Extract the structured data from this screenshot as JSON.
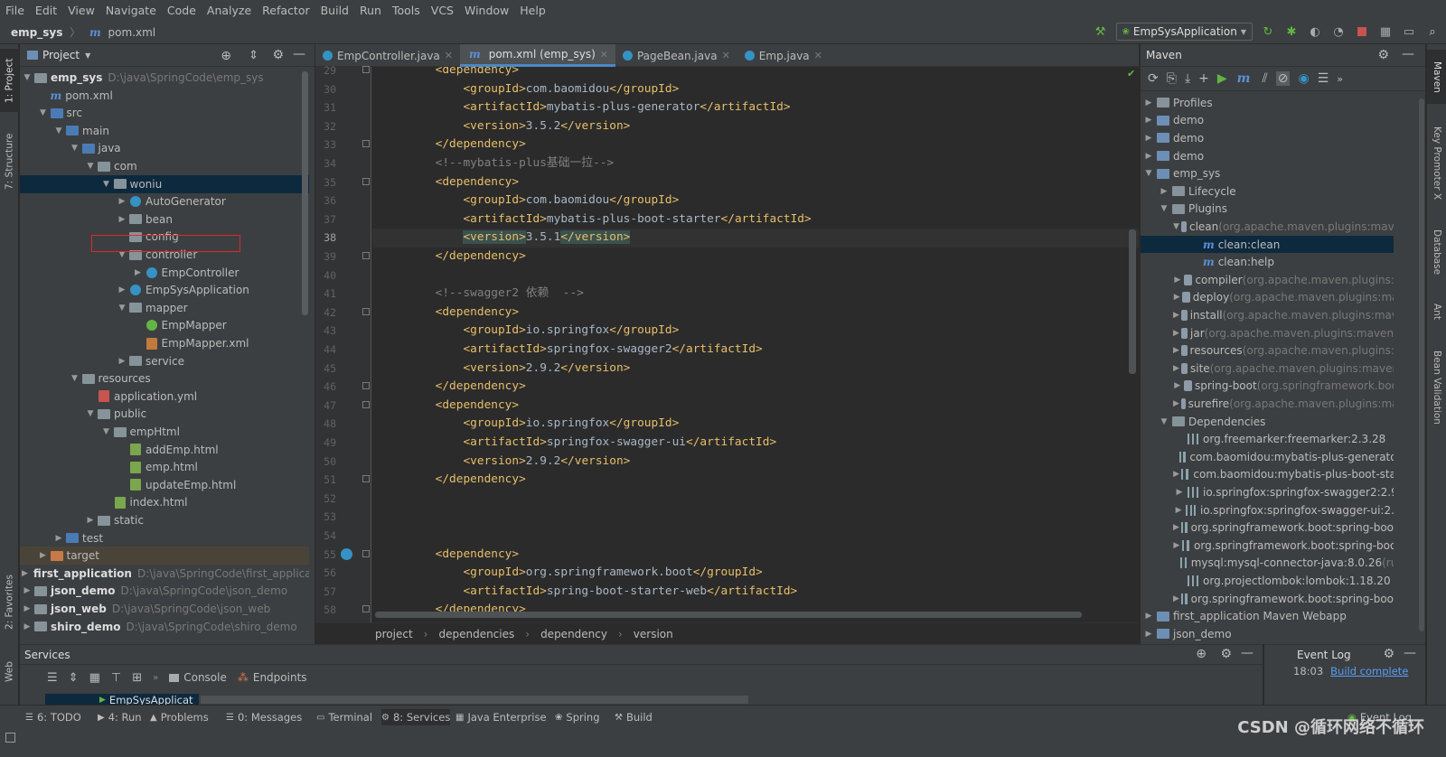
{
  "menu": [
    "File",
    "Edit",
    "View",
    "Navigate",
    "Code",
    "Analyze",
    "Refactor",
    "Build",
    "Run",
    "Tools",
    "VCS",
    "Window",
    "Help"
  ],
  "nav": {
    "project": "emp_sys",
    "file": "pom.xml",
    "run_config": "EmpSysApplication"
  },
  "left_tabs": {
    "project": "1: Project",
    "structure": "7: Structure",
    "favorites": "2: Favorites",
    "web": "Web"
  },
  "right_tabs": {
    "maven": "Maven",
    "key_promoter": "Key Promoter X",
    "database": "Database",
    "ant": "Ant",
    "bean_validation": "Bean Validation"
  },
  "project_panel": {
    "title": "Project",
    "rows": [
      {
        "label": "emp_sys",
        "path": "D:\\java\\SpringCode\\emp_sys",
        "type": "folder",
        "depth": 0,
        "arrow": "▼",
        "bold": true
      },
      {
        "label": "pom.xml",
        "type": "maven",
        "depth": 1,
        "arrow": ""
      },
      {
        "label": "src",
        "type": "folder",
        "depth": 1,
        "arrow": "▼"
      },
      {
        "label": "main",
        "type": "folder",
        "depth": 2,
        "arrow": "▼"
      },
      {
        "label": "java",
        "type": "folder",
        "depth": 3,
        "arrow": "▼"
      },
      {
        "label": "com",
        "type": "pkg",
        "depth": 4,
        "arrow": "▼"
      },
      {
        "label": "woniu",
        "type": "pkg",
        "depth": 5,
        "arrow": "▼",
        "selected": true
      },
      {
        "label": "AutoGenerator",
        "type": "java",
        "depth": 6,
        "arrow": "▶"
      },
      {
        "label": "bean",
        "type": "pkg",
        "depth": 6,
        "arrow": "▶"
      },
      {
        "label": "config",
        "type": "pkg",
        "depth": 6,
        "arrow": "",
        "boxed": true
      },
      {
        "label": "controller",
        "type": "pkg",
        "depth": 6,
        "arrow": "▼"
      },
      {
        "label": "EmpController",
        "type": "java",
        "depth": 7,
        "arrow": "▶"
      },
      {
        "label": "EmpSysApplication",
        "type": "java",
        "depth": 6,
        "arrow": "▶"
      },
      {
        "label": "mapper",
        "type": "pkg",
        "depth": 6,
        "arrow": "▼"
      },
      {
        "label": "EmpMapper",
        "type": "iface",
        "depth": 7,
        "arrow": ""
      },
      {
        "label": "EmpMapper.xml",
        "type": "xml",
        "depth": 7,
        "arrow": ""
      },
      {
        "label": "service",
        "type": "pkg",
        "depth": 6,
        "arrow": "▶"
      },
      {
        "label": "resources",
        "type": "folder",
        "depth": 3,
        "arrow": "▼"
      },
      {
        "label": "application.yml",
        "type": "yml",
        "depth": 4,
        "arrow": ""
      },
      {
        "label": "public",
        "type": "folder",
        "depth": 4,
        "arrow": "▼"
      },
      {
        "label": "empHtml",
        "type": "folder",
        "depth": 5,
        "arrow": "▼"
      },
      {
        "label": "addEmp.html",
        "type": "html",
        "depth": 6,
        "arrow": ""
      },
      {
        "label": "emp.html",
        "type": "html",
        "depth": 6,
        "arrow": ""
      },
      {
        "label": "updateEmp.html",
        "type": "html",
        "depth": 6,
        "arrow": ""
      },
      {
        "label": "index.html",
        "type": "html",
        "depth": 5,
        "arrow": ""
      },
      {
        "label": "static",
        "type": "folder",
        "depth": 4,
        "arrow": "▶"
      },
      {
        "label": "test",
        "type": "folder",
        "depth": 2,
        "arrow": "▶"
      },
      {
        "label": "target",
        "type": "folder",
        "depth": 1,
        "arrow": "▶",
        "target": true
      },
      {
        "label": "first_application",
        "path": "D:\\java\\SpringCode\\first_application",
        "type": "folder",
        "depth": 0,
        "arrow": "▶",
        "bold": true
      },
      {
        "label": "json_demo",
        "path": "D:\\java\\SpringCode\\json_demo",
        "type": "folder",
        "depth": 0,
        "arrow": "▶",
        "bold": true
      },
      {
        "label": "json_web",
        "path": "D:\\java\\SpringCode\\json_web",
        "type": "folder",
        "depth": 0,
        "arrow": "▶",
        "bold": true
      },
      {
        "label": "shiro_demo",
        "path": "D:\\java\\SpringCode\\shiro_demo",
        "type": "folder",
        "depth": 0,
        "arrow": "▶",
        "bold": true
      }
    ]
  },
  "editor": {
    "tabs": [
      {
        "label": "EmpController.java",
        "active": false
      },
      {
        "label": "pom.xml (emp_sys)",
        "active": true
      },
      {
        "label": "PageBean.java",
        "active": false
      },
      {
        "label": "Emp.java",
        "active": false
      }
    ],
    "lines": [
      {
        "n": "29",
        "indent": 2,
        "parts": [
          [
            "tg",
            "<dependency>"
          ]
        ]
      },
      {
        "n": "30",
        "indent": 3,
        "parts": [
          [
            "tg",
            "<groupId>"
          ],
          [
            "tx",
            "com.baomidou"
          ],
          [
            "tg",
            "</groupId>"
          ]
        ]
      },
      {
        "n": "31",
        "indent": 3,
        "parts": [
          [
            "tg",
            "<artifactId>"
          ],
          [
            "tx",
            "mybatis-plus-generator"
          ],
          [
            "tg",
            "</artifactId>"
          ]
        ]
      },
      {
        "n": "32",
        "indent": 3,
        "parts": [
          [
            "tg",
            "<version>"
          ],
          [
            "tx",
            "3.5.2"
          ],
          [
            "tg",
            "</version>"
          ]
        ]
      },
      {
        "n": "33",
        "indent": 2,
        "parts": [
          [
            "tg",
            "</dependency>"
          ]
        ]
      },
      {
        "n": "34",
        "indent": 2,
        "parts": [
          [
            "cm",
            "<!--mybatis-plus基础一拉-->"
          ]
        ]
      },
      {
        "n": "35",
        "indent": 2,
        "parts": [
          [
            "tg",
            "<dependency>"
          ]
        ]
      },
      {
        "n": "36",
        "indent": 3,
        "parts": [
          [
            "tg",
            "<groupId>"
          ],
          [
            "tx",
            "com.baomidou"
          ],
          [
            "tg",
            "</groupId>"
          ]
        ]
      },
      {
        "n": "37",
        "indent": 3,
        "parts": [
          [
            "tg",
            "<artifactId>"
          ],
          [
            "tx",
            "mybatis-plus-boot-starter"
          ],
          [
            "tg",
            "</artifactId>"
          ]
        ]
      },
      {
        "n": "38",
        "indent": 3,
        "parts": [
          [
            "tg",
            "<version>"
          ],
          [
            "tx",
            "3.5.1"
          ],
          [
            "tg",
            "</version>"
          ]
        ],
        "current": true
      },
      {
        "n": "39",
        "indent": 2,
        "parts": [
          [
            "tg",
            "</dependency>"
          ]
        ]
      },
      {
        "n": "40",
        "indent": 0,
        "parts": []
      },
      {
        "n": "41",
        "indent": 2,
        "parts": [
          [
            "cm",
            "<!--swagger2 依赖  -->"
          ]
        ]
      },
      {
        "n": "42",
        "indent": 2,
        "parts": [
          [
            "tg",
            "<dependency>"
          ]
        ]
      },
      {
        "n": "43",
        "indent": 3,
        "parts": [
          [
            "tg",
            "<groupId>"
          ],
          [
            "tx",
            "io.springfox"
          ],
          [
            "tg",
            "</groupId>"
          ]
        ]
      },
      {
        "n": "44",
        "indent": 3,
        "parts": [
          [
            "tg",
            "<artifactId>"
          ],
          [
            "tx",
            "springfox-swagger2"
          ],
          [
            "tg",
            "</artifactId>"
          ]
        ]
      },
      {
        "n": "45",
        "indent": 3,
        "parts": [
          [
            "tg",
            "<version>"
          ],
          [
            "tx",
            "2.9.2"
          ],
          [
            "tg",
            "</version>"
          ]
        ]
      },
      {
        "n": "46",
        "indent": 2,
        "parts": [
          [
            "tg",
            "</dependency>"
          ]
        ]
      },
      {
        "n": "47",
        "indent": 2,
        "parts": [
          [
            "tg",
            "<dependency>"
          ]
        ]
      },
      {
        "n": "48",
        "indent": 3,
        "parts": [
          [
            "tg",
            "<groupId>"
          ],
          [
            "tx",
            "io.springfox"
          ],
          [
            "tg",
            "</groupId>"
          ]
        ]
      },
      {
        "n": "49",
        "indent": 3,
        "parts": [
          [
            "tg",
            "<artifactId>"
          ],
          [
            "tx",
            "springfox-swagger-ui"
          ],
          [
            "tg",
            "</artifactId>"
          ]
        ]
      },
      {
        "n": "50",
        "indent": 3,
        "parts": [
          [
            "tg",
            "<version>"
          ],
          [
            "tx",
            "2.9.2"
          ],
          [
            "tg",
            "</version>"
          ]
        ]
      },
      {
        "n": "51",
        "indent": 2,
        "parts": [
          [
            "tg",
            "</dependency>"
          ]
        ]
      },
      {
        "n": "52",
        "indent": 0,
        "parts": []
      },
      {
        "n": "53",
        "indent": 0,
        "parts": []
      },
      {
        "n": "54",
        "indent": 0,
        "parts": []
      },
      {
        "n": "55",
        "indent": 2,
        "parts": [
          [
            "tg",
            "<dependency>"
          ]
        ]
      },
      {
        "n": "56",
        "indent": 3,
        "parts": [
          [
            "tg",
            "<groupId>"
          ],
          [
            "tx",
            "org.springframework.boot"
          ],
          [
            "tg",
            "</groupId>"
          ]
        ]
      },
      {
        "n": "57",
        "indent": 3,
        "parts": [
          [
            "tg",
            "<artifactId>"
          ],
          [
            "tx",
            "spring-boot-starter-web"
          ],
          [
            "tg",
            "</artifactId>"
          ]
        ]
      },
      {
        "n": "58",
        "indent": 2,
        "parts": [
          [
            "tg",
            "</dependency>"
          ]
        ]
      }
    ],
    "breadcrumb": [
      "project",
      "dependencies",
      "dependency",
      "version"
    ]
  },
  "maven": {
    "title": "Maven",
    "rows": [
      {
        "label": "Profiles",
        "depth": 0,
        "arrow": "▶",
        "icon": "folder"
      },
      {
        "label": "demo",
        "depth": 0,
        "arrow": "▶",
        "icon": "maven"
      },
      {
        "label": "demo",
        "depth": 0,
        "arrow": "▶",
        "icon": "maven"
      },
      {
        "label": "demo",
        "depth": 0,
        "arrow": "▶",
        "icon": "maven"
      },
      {
        "label": "emp_sys",
        "depth": 0,
        "arrow": "▼",
        "icon": "maven"
      },
      {
        "label": "Lifecycle",
        "depth": 1,
        "arrow": "▶",
        "icon": "folder"
      },
      {
        "label": "Plugins",
        "depth": 1,
        "arrow": "▼",
        "icon": "folder"
      },
      {
        "label": "clean",
        "grey": " (org.apache.maven.plugins:maven-",
        "depth": 2,
        "arrow": "▼",
        "icon": "gear"
      },
      {
        "label": "clean:clean",
        "depth": 3,
        "arrow": "",
        "icon": "goal",
        "selected": true
      },
      {
        "label": "clean:help",
        "depth": 3,
        "arrow": "",
        "icon": "goal"
      },
      {
        "label": "compiler",
        "grey": " (org.apache.maven.plugins:ma",
        "depth": 2,
        "arrow": "▶",
        "icon": "gear"
      },
      {
        "label": "deploy",
        "grey": " (org.apache.maven.plugins:mave",
        "depth": 2,
        "arrow": "▶",
        "icon": "gear"
      },
      {
        "label": "install",
        "grey": " (org.apache.maven.plugins:maven",
        "depth": 2,
        "arrow": "▶",
        "icon": "gear"
      },
      {
        "label": "jar",
        "grey": " (org.apache.maven.plugins:maven-jar",
        "depth": 2,
        "arrow": "▶",
        "icon": "gear"
      },
      {
        "label": "resources",
        "grey": " (org.apache.maven.plugins:ma",
        "depth": 2,
        "arrow": "▶",
        "icon": "gear"
      },
      {
        "label": "site",
        "grey": " (org.apache.maven.plugins:maven-si",
        "depth": 2,
        "arrow": "▶",
        "icon": "gear"
      },
      {
        "label": "spring-boot",
        "grey": " (org.springframework.boot:s",
        "depth": 2,
        "arrow": "▶",
        "icon": "gear"
      },
      {
        "label": "surefire",
        "grey": " (org.apache.maven.plugins:mave",
        "depth": 2,
        "arrow": "▶",
        "icon": "gear"
      },
      {
        "label": "Dependencies",
        "depth": 1,
        "arrow": "▼",
        "icon": "folder"
      },
      {
        "label": "org.freemarker:freemarker:2.3.28",
        "depth": 2,
        "arrow": "",
        "icon": "dep"
      },
      {
        "label": "com.baomidou:mybatis-plus-generator:3",
        "depth": 2,
        "arrow": "",
        "icon": "dep"
      },
      {
        "label": "com.baomidou:mybatis-plus-boot-starte",
        "depth": 2,
        "arrow": "▶",
        "icon": "dep"
      },
      {
        "label": "io.springfox:springfox-swagger2:2.9.2",
        "depth": 2,
        "arrow": "▶",
        "icon": "dep"
      },
      {
        "label": "io.springfox:springfox-swagger-ui:2.9.2",
        "depth": 2,
        "arrow": "▶",
        "icon": "dep"
      },
      {
        "label": "org.springframework.boot:spring-boot-st",
        "depth": 2,
        "arrow": "▶",
        "icon": "dep"
      },
      {
        "label": "org.springframework.boot:spring-boot-d",
        "depth": 2,
        "arrow": "▶",
        "icon": "dep"
      },
      {
        "label": "mysql:mysql-connector-java:8.0.26",
        "grey": " (runti",
        "depth": 2,
        "arrow": "",
        "icon": "dep"
      },
      {
        "label": "org.projectlombok:lombok:1.18.20",
        "depth": 2,
        "arrow": "",
        "icon": "dep"
      },
      {
        "label": "org.springframework.boot:spring-boot-st",
        "depth": 2,
        "arrow": "▶",
        "icon": "dep"
      },
      {
        "label": "first_application Maven Webapp",
        "depth": 0,
        "arrow": "▶",
        "icon": "maven"
      },
      {
        "label": "json_demo",
        "depth": 0,
        "arrow": "▶",
        "icon": "maven"
      }
    ]
  },
  "services": {
    "title": "Services",
    "console": "Console",
    "endpoints": "Endpoints",
    "item": "EmpSysApplicat"
  },
  "eventlog": {
    "title": "Event Log",
    "time": "18:03",
    "link": "Build complete"
  },
  "bottom_tools": [
    {
      "key": "6",
      "label": "6: TODO"
    },
    {
      "key": "4",
      "label": "4: Run"
    },
    {
      "key": "",
      "label": "Problems"
    },
    {
      "key": "0",
      "label": "0: Messages"
    },
    {
      "key": "",
      "label": "Terminal"
    },
    {
      "key": "8",
      "label": "8: Services",
      "active": true
    },
    {
      "key": "",
      "label": "Java Enterprise"
    },
    {
      "key": "",
      "label": "Spring"
    },
    {
      "key": "",
      "label": "Build"
    }
  ],
  "status": {
    "event_log": "Event Log",
    "watermark": "CSDN @循环网络不循环"
  }
}
